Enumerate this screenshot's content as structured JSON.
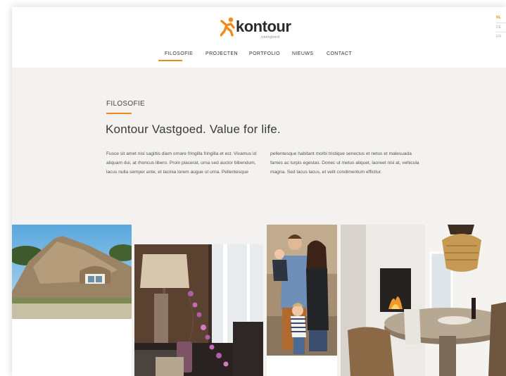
{
  "brand": {
    "name": "kontour",
    "tagline": "vastgoed",
    "accent_color": "#f08a1c",
    "logo_icon": "kontour-figure-icon"
  },
  "nav": {
    "items": [
      {
        "label": "FILOSOFIE",
        "active": true
      },
      {
        "label": "PROJECTEN",
        "active": false
      },
      {
        "label": "PORTFOLIO",
        "active": false
      },
      {
        "label": "NIEUWS",
        "active": false
      },
      {
        "label": "CONTACT",
        "active": false
      }
    ]
  },
  "language": {
    "items": [
      {
        "label": "NL",
        "active": true
      },
      {
        "label": "DE",
        "active": false
      },
      {
        "label": "EN",
        "active": false
      }
    ]
  },
  "section": {
    "label": "FILOSOFIE",
    "headline": "Kontour Vastgoed. Value for life.",
    "body_left": "Fusce sit amet nisl sagittis diam ornare fringilla fringilla et est. Vivamus id aliquam dui, at rhoncus libero. Proin placerat, urna sed auctor bibendum, lacus nulla semper ante, et lacinia lorem augue ut urna. Pellentesque",
    "body_right": "pellentesque habitant morbi tristique senectus et netus et malesuada fames ac turpis egestas. Donec ut metus aliquet, laoreet nisi at, vehicula magna. Sed lacus lacus, et velit condimentum efficitur."
  },
  "photos": [
    {
      "subject": "thatched-roof-house"
    },
    {
      "subject": "living-room-lamp-flowers"
    },
    {
      "subject": "family-portrait"
    },
    {
      "subject": "dining-room-fireplace"
    }
  ]
}
